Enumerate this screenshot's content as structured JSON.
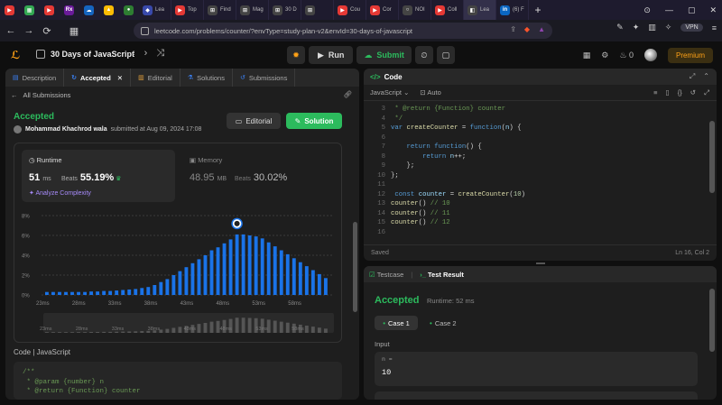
{
  "browser": {
    "tabs": [
      {
        "label": "",
        "color": "#e53935",
        "glyph": "▶",
        "pinned": true
      },
      {
        "label": "",
        "color": "#34a853",
        "glyph": "▦",
        "pinned": true
      },
      {
        "label": "",
        "color": "#e53935",
        "glyph": "▶",
        "pinned": true
      },
      {
        "label": "",
        "color": "#6a1b9a",
        "glyph": "Rx",
        "pinned": true
      },
      {
        "label": "",
        "color": "#1565c0",
        "glyph": "☁",
        "pinned": true
      },
      {
        "label": "",
        "color": "#fbbc04",
        "glyph": "▲",
        "pinned": true
      },
      {
        "label": "",
        "color": "#2e7d32",
        "glyph": "●",
        "pinned": true
      },
      {
        "label": "Lea",
        "color": "#3949ab",
        "glyph": "◆"
      },
      {
        "label": "Top",
        "color": "#e53935",
        "glyph": "▶"
      },
      {
        "label": "Find",
        "color": "#444",
        "glyph": "⊞"
      },
      {
        "label": "Mag",
        "color": "#444",
        "glyph": "⊞"
      },
      {
        "label": "30 D",
        "color": "#444",
        "glyph": "⊞"
      },
      {
        "label": "",
        "color": "#444",
        "glyph": "⊞"
      },
      {
        "label": "Cou",
        "color": "#e53935",
        "glyph": "▶"
      },
      {
        "label": "Cor",
        "color": "#e53935",
        "glyph": "▶"
      },
      {
        "label": "NOI",
        "color": "#444",
        "glyph": "○"
      },
      {
        "label": "Coll",
        "color": "#e53935",
        "glyph": "▶"
      },
      {
        "label": "Lea",
        "color": "#444",
        "glyph": "◧",
        "active": true
      },
      {
        "label": "(6) F",
        "color": "#0a66c2",
        "glyph": "in"
      }
    ],
    "new_tab": "+",
    "window_controls": [
      "⊙",
      "—",
      "▢",
      "✕"
    ],
    "url": "leetcode.com/problems/counter/?envType=study-plan-v2&envId=30-days-of-javascript",
    "vpn": "VPN"
  },
  "lc": {
    "title": "30 Days of JavaScript",
    "run": "Run",
    "submit": "Submit",
    "streak": "0",
    "premium": "Premium"
  },
  "left": {
    "tabs": [
      {
        "label": "Description",
        "icon": "▤",
        "cls": "ic-blue"
      },
      {
        "label": "Accepted",
        "icon": "↻",
        "cls": "ic-blue",
        "active": true,
        "close": "✕"
      },
      {
        "label": "Editorial",
        "icon": "▥",
        "cls": "ic-yellow"
      },
      {
        "label": "Solutions",
        "icon": "⚗",
        "cls": "ic-blue"
      },
      {
        "label": "Submissions",
        "icon": "↺",
        "cls": "ic-blue"
      }
    ],
    "all_submissions": "All Submissions",
    "status": "Accepted",
    "author": "Mohammad Khachrod wala",
    "submitted": "submitted at Aug 09, 2024 17:08",
    "editorial_btn": "Editorial",
    "solution_btn": "Solution",
    "runtime_label": "Runtime",
    "runtime_value": "51",
    "runtime_unit": "ms",
    "runtime_beats_label": "Beats",
    "runtime_beats": "55.19%",
    "analyze": "Analyze Complexity",
    "memory_label": "Memory",
    "memory_value": "48.95",
    "memory_unit": "MB",
    "memory_beats_label": "Beats",
    "memory_beats": "30.02%",
    "code_lang": "Code  |  JavaScript",
    "code_preview": [
      "/**",
      " * @param {number} n",
      " * @return {Function} counter"
    ]
  },
  "chart_data": {
    "type": "bar",
    "title": "",
    "ylabel": "",
    "xlabel": "",
    "yticks": [
      "0%",
      "2%",
      "4%",
      "6%",
      "8%"
    ],
    "ylim": [
      0,
      8
    ],
    "xticks": [
      "23ms",
      "28ms",
      "33ms",
      "38ms",
      "43ms",
      "48ms",
      "53ms",
      "58ms"
    ],
    "values": [
      0.3,
      0.3,
      0.3,
      0.3,
      0.3,
      0.3,
      0.3,
      0.35,
      0.35,
      0.4,
      0.4,
      0.45,
      0.5,
      0.55,
      0.6,
      0.7,
      0.8,
      1.0,
      1.3,
      1.6,
      2.0,
      2.4,
      2.8,
      3.2,
      3.6,
      4.0,
      4.5,
      4.8,
      5.2,
      5.6,
      6.1,
      6.1,
      6.0,
      5.9,
      5.7,
      5.3,
      4.9,
      4.5,
      4.1,
      3.7,
      3.3,
      2.9,
      2.5,
      2.1,
      1.7
    ],
    "highlight_index": 30,
    "grid": true,
    "bar_color": "#1a73e8",
    "grid_color": "#3a3a3a"
  },
  "code": {
    "header": "Code",
    "language": "JavaScript",
    "auto": "Auto",
    "lines": [
      {
        "n": "3",
        "html": "<span class=\"cm\"> * @return {Function} counter</span>"
      },
      {
        "n": "4",
        "html": "<span class=\"cm\"> */</span>"
      },
      {
        "n": "5",
        "html": "<span class=\"kw\">var</span> <span class=\"fn\">createCounter</span> = <span class=\"kw\">function</span>(<span class=\"vr\">n</span>) {"
      },
      {
        "n": "6",
        "html": ""
      },
      {
        "n": "7",
        "html": "    <span class=\"kw\">return</span> <span class=\"kw\">function</span>() {"
      },
      {
        "n": "8",
        "html": "        <span class=\"kw\">return</span> <span class=\"vr\">n</span>++;"
      },
      {
        "n": "9",
        "html": "    };"
      },
      {
        "n": "10",
        "html": "};"
      },
      {
        "n": "11",
        "html": ""
      },
      {
        "n": "12",
        "html": " <span class=\"kw\">const</span> <span class=\"vr\">counter</span> = <span class=\"fn\">createCounter</span>(<span class=\"nm\">10</span>)"
      },
      {
        "n": "13",
        "html": "<span class=\"fn\">counter</span>() <span class=\"cm\">// 10</span>"
      },
      {
        "n": "14",
        "html": "<span class=\"fn\">counter</span>() <span class=\"cm\">// 11</span>"
      },
      {
        "n": "15",
        "html": "<span class=\"fn\">counter</span>() <span class=\"cm\">// 12</span>"
      },
      {
        "n": "16",
        "html": ""
      }
    ],
    "partial_top": " * @return {function} counter",
    "saved": "Saved",
    "cursor": "Ln 16, Col 2"
  },
  "result": {
    "testcase_tab": "Testcase",
    "result_tab": "Test Result",
    "status": "Accepted",
    "runtime": "Runtime: 52 ms",
    "case1": "Case 1",
    "case2": "Case 2",
    "input_label": "Input",
    "param_name": "n =",
    "param_value": "10"
  }
}
